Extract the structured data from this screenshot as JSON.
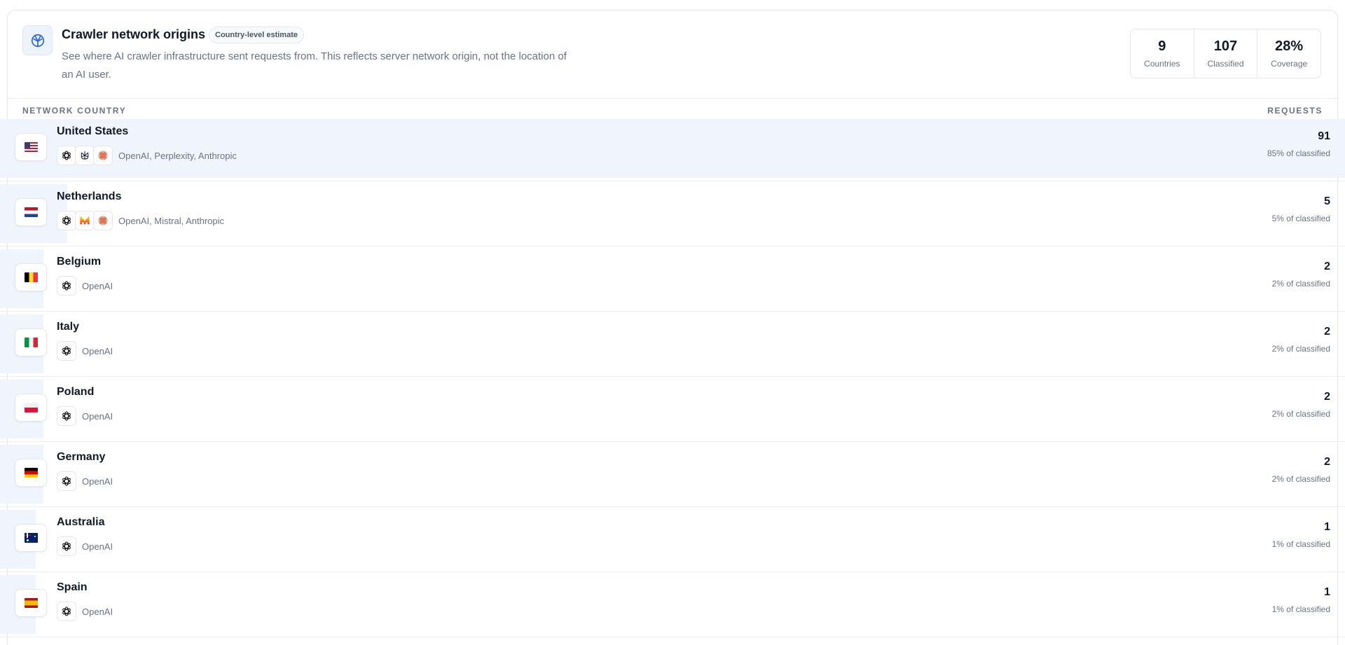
{
  "header": {
    "title": "Crawler network origins",
    "badge": "Country-level estimate",
    "description": "See where AI crawler infrastructure sent requests from. This reflects server network origin, not the location of an AI user."
  },
  "stats": [
    {
      "value": "9",
      "label": "Countries"
    },
    {
      "value": "107",
      "label": "Classified"
    },
    {
      "value": "28%",
      "label": "Coverage"
    }
  ],
  "columns": {
    "left": "NETWORK COUNTRY",
    "right": "REQUESTS"
  },
  "rows": [
    {
      "country": "United States",
      "flag": "us",
      "providers_text": "OpenAI, Perplexity, Anthropic",
      "provider_icons": [
        "openai-icon",
        "perplexity-icon",
        "anthropic-icon"
      ],
      "requests": "91",
      "share": "85% of classified",
      "share_fraction": 0.85
    },
    {
      "country": "Netherlands",
      "flag": "nl",
      "providers_text": "OpenAI, Mistral, Anthropic",
      "provider_icons": [
        "openai-icon",
        "mistral-icon",
        "anthropic-icon"
      ],
      "requests": "5",
      "share": "5% of classified",
      "share_fraction": 0.05
    },
    {
      "country": "Belgium",
      "flag": "be",
      "providers_text": "OpenAI",
      "provider_icons": [
        "openai-icon"
      ],
      "requests": "2",
      "share": "2% of classified",
      "share_fraction": 0.02
    },
    {
      "country": "Italy",
      "flag": "it",
      "providers_text": "OpenAI",
      "provider_icons": [
        "openai-icon"
      ],
      "requests": "2",
      "share": "2% of classified",
      "share_fraction": 0.02
    },
    {
      "country": "Poland",
      "flag": "pl",
      "providers_text": "OpenAI",
      "provider_icons": [
        "openai-icon"
      ],
      "requests": "2",
      "share": "2% of classified",
      "share_fraction": 0.02
    },
    {
      "country": "Germany",
      "flag": "de",
      "providers_text": "OpenAI",
      "provider_icons": [
        "openai-icon"
      ],
      "requests": "2",
      "share": "2% of classified",
      "share_fraction": 0.02
    },
    {
      "country": "Australia",
      "flag": "au",
      "providers_text": "OpenAI",
      "provider_icons": [
        "openai-icon"
      ],
      "requests": "1",
      "share": "1% of classified",
      "share_fraction": 0.01
    },
    {
      "country": "Spain",
      "flag": "es",
      "providers_text": "OpenAI",
      "provider_icons": [
        "openai-icon"
      ],
      "requests": "1",
      "share": "1% of classified",
      "share_fraction": 0.01
    }
  ],
  "colors": {
    "accent": "#2563eb",
    "bar": "#eff4fd",
    "anthropic": "#d97757",
    "mistral": "#f97316"
  }
}
